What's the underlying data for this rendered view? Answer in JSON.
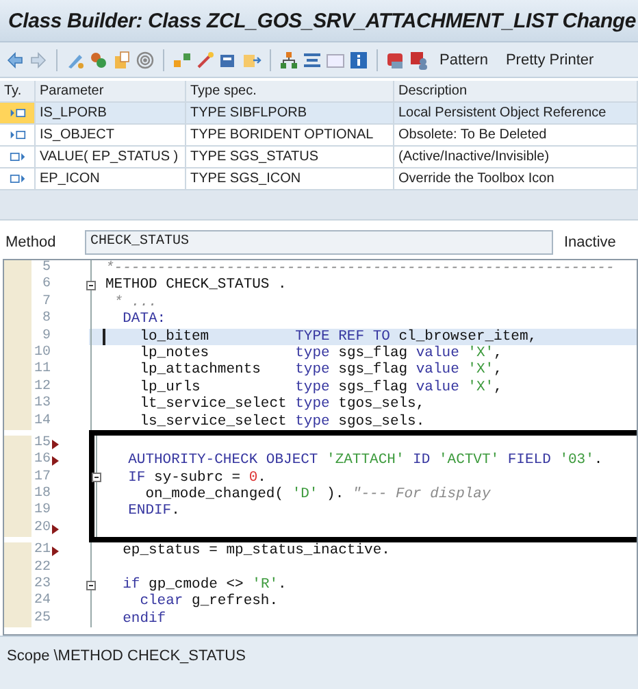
{
  "window": {
    "title": "Class Builder: Class ZCL_GOS_SRV_ATTACHMENT_LIST Change"
  },
  "toolbar": {
    "buttons": [
      "Pattern",
      "Pretty Printer"
    ]
  },
  "parameters": {
    "columns": [
      "Ty.",
      "Parameter",
      "Type spec.",
      "Description"
    ],
    "rows": [
      {
        "kind": "importing",
        "selected": true,
        "parameter": "IS_LPORB",
        "type_spec": "TYPE SIBFLPORB",
        "description": "Local Persistent Object Reference"
      },
      {
        "kind": "importing",
        "selected": false,
        "parameter": "IS_OBJECT",
        "type_spec": "TYPE BORIDENT OPTIONAL",
        "description": "Obsolete: To Be Deleted"
      },
      {
        "kind": "returning",
        "selected": false,
        "parameter": "VALUE( EP_STATUS )",
        "type_spec": "TYPE SGS_STATUS",
        "description": "(Active/Inactive/Invisible)"
      },
      {
        "kind": "exporting",
        "selected": false,
        "parameter": "EP_ICON",
        "type_spec": "TYPE SGS_ICON",
        "description": "Override the Toolbox Icon"
      }
    ]
  },
  "method": {
    "label": "Method",
    "value": "CHECK_STATUS",
    "status": "Inactive"
  },
  "editor": {
    "blocks": [
      {
        "lines": [
          {
            "number": "5",
            "tokens": [
              {
                "kind": "comment",
                "text": "*----------------------------------------------------------"
              }
            ]
          },
          {
            "number": "6",
            "foldable": true,
            "tokens": [
              {
                "kind": "text",
                "text": "METHOD CHECK_STATUS ."
              }
            ]
          },
          {
            "number": "7",
            "tokens": [
              {
                "kind": "comment",
                "text": " * ..."
              }
            ]
          },
          {
            "number": "8",
            "tokens": [
              {
                "kind": "keyword",
                "text": "  DATA:"
              }
            ]
          },
          {
            "number": "9",
            "current": true,
            "tokens": [
              {
                "kind": "text",
                "text": "    lo_bitem          "
              },
              {
                "kind": "keyword",
                "text": "TYPE REF TO"
              },
              {
                "kind": "text",
                "text": " cl_browser_item,"
              }
            ]
          },
          {
            "number": "10",
            "tokens": [
              {
                "kind": "text",
                "text": "    lp_notes          "
              },
              {
                "kind": "keyword",
                "text": "type"
              },
              {
                "kind": "text",
                "text": " sgs_flag "
              },
              {
                "kind": "keyword",
                "text": "value "
              },
              {
                "kind": "string",
                "text": "'X'"
              },
              {
                "kind": "text",
                "text": ","
              }
            ]
          },
          {
            "number": "11",
            "tokens": [
              {
                "kind": "text",
                "text": "    lp_attachments    "
              },
              {
                "kind": "keyword",
                "text": "type"
              },
              {
                "kind": "text",
                "text": " sgs_flag "
              },
              {
                "kind": "keyword",
                "text": "value "
              },
              {
                "kind": "string",
                "text": "'X'"
              },
              {
                "kind": "text",
                "text": ","
              }
            ]
          },
          {
            "number": "12",
            "tokens": [
              {
                "kind": "text",
                "text": "    lp_urls           "
              },
              {
                "kind": "keyword",
                "text": "type"
              },
              {
                "kind": "text",
                "text": " sgs_flag "
              },
              {
                "kind": "keyword",
                "text": "value "
              },
              {
                "kind": "string",
                "text": "'X'"
              },
              {
                "kind": "text",
                "text": ","
              }
            ]
          },
          {
            "number": "13",
            "tokens": [
              {
                "kind": "text",
                "text": "    lt_service_select "
              },
              {
                "kind": "keyword",
                "text": "type"
              },
              {
                "kind": "text",
                "text": " tgos_sels,"
              }
            ]
          },
          {
            "number": "14",
            "tokens": [
              {
                "kind": "text",
                "text": "    ls_service_select "
              },
              {
                "kind": "keyword",
                "text": "type"
              },
              {
                "kind": "text",
                "text": " sgos_sels."
              }
            ]
          }
        ]
      },
      {
        "framed": true,
        "lines": [
          {
            "number": "15",
            "marker": true
          },
          {
            "number": "16",
            "marker": true,
            "tokens": [
              {
                "kind": "keyword",
                "text": "  AUTHORITY-CHECK OBJECT "
              },
              {
                "kind": "string",
                "text": "'ZATTACH'"
              },
              {
                "kind": "keyword",
                "text": " ID "
              },
              {
                "kind": "string",
                "text": "'ACTVT'"
              },
              {
                "kind": "keyword",
                "text": " FIELD "
              },
              {
                "kind": "string",
                "text": "'03'"
              },
              {
                "kind": "text",
                "text": "."
              }
            ]
          },
          {
            "number": "17",
            "foldable": true,
            "tokens": [
              {
                "kind": "keyword",
                "text": "  IF"
              },
              {
                "kind": "text",
                "text": " sy-subrc = "
              },
              {
                "kind": "number",
                "text": "0"
              },
              {
                "kind": "text",
                "text": "."
              }
            ]
          },
          {
            "number": "18",
            "tokens": [
              {
                "kind": "text",
                "text": "    on_mode_changed( "
              },
              {
                "kind": "string",
                "text": "'D'"
              },
              {
                "kind": "text",
                "text": " ). "
              },
              {
                "kind": "comment",
                "text": "\"--- For display"
              }
            ]
          },
          {
            "number": "19",
            "tokens": [
              {
                "kind": "keyword",
                "text": "  ENDIF"
              },
              {
                "kind": "text",
                "text": "."
              }
            ]
          },
          {
            "number": "20",
            "marker": true
          }
        ]
      },
      {
        "lines": [
          {
            "number": "21",
            "marker": true,
            "tokens": [
              {
                "kind": "text",
                "text": "  ep_status = mp_status_inactive."
              }
            ]
          },
          {
            "number": "22"
          },
          {
            "number": "23",
            "foldable": true,
            "tokens": [
              {
                "kind": "keyword",
                "text": "  if"
              },
              {
                "kind": "text",
                "text": " gp_cmode <> "
              },
              {
                "kind": "string",
                "text": "'R'"
              },
              {
                "kind": "text",
                "text": "."
              }
            ]
          },
          {
            "number": "24",
            "tokens": [
              {
                "kind": "keyword",
                "text": "    clear"
              },
              {
                "kind": "text",
                "text": " g_refresh."
              }
            ]
          },
          {
            "number": "25",
            "tokens": [
              {
                "kind": "keyword",
                "text": "  endif"
              }
            ]
          }
        ]
      }
    ]
  },
  "status_bar": {
    "text": "Scope \\METHOD CHECK_STATUS"
  }
}
